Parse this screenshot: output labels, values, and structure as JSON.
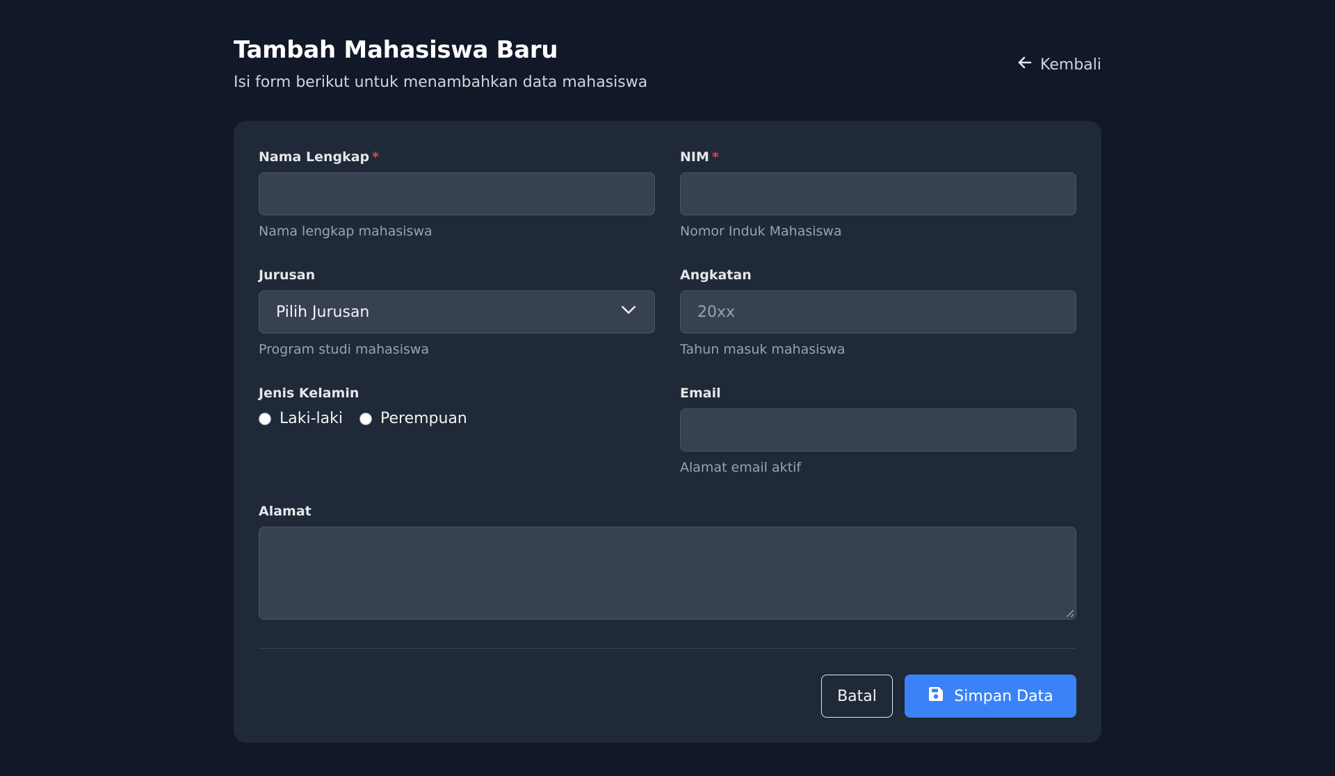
{
  "header": {
    "title": "Tambah Mahasiswa Baru",
    "subtitle": "Isi form berikut untuk menambahkan data mahasiswa",
    "back_label": "Kembali"
  },
  "form": {
    "nama": {
      "label": "Nama Lengkap",
      "required_mark": "*",
      "value": "",
      "help": "Nama lengkap mahasiswa"
    },
    "nim": {
      "label": "NIM",
      "required_mark": "*",
      "value": "",
      "help": "Nomor Induk Mahasiswa"
    },
    "jurusan": {
      "label": "Jurusan",
      "selected": "Pilih Jurusan",
      "help": "Program studi mahasiswa"
    },
    "angkatan": {
      "label": "Angkatan",
      "placeholder": "20xx",
      "value": "",
      "help": "Tahun masuk mahasiswa"
    },
    "jenis_kelamin": {
      "label": "Jenis Kelamin",
      "options": [
        "Laki-laki",
        "Perempuan"
      ],
      "selected": null
    },
    "email": {
      "label": "Email",
      "value": "",
      "help": "Alamat email aktif"
    },
    "alamat": {
      "label": "Alamat",
      "value": ""
    }
  },
  "actions": {
    "cancel_label": "Batal",
    "save_label": "Simpan Data"
  },
  "icons": {
    "back": "arrow-left-icon",
    "select": "chevron-down-icon",
    "save": "floppy-disk-icon"
  },
  "colors": {
    "background": "#111827",
    "card": "#1f2937",
    "input": "#374151",
    "accent": "#3b82f6",
    "required": "#ef4444"
  }
}
